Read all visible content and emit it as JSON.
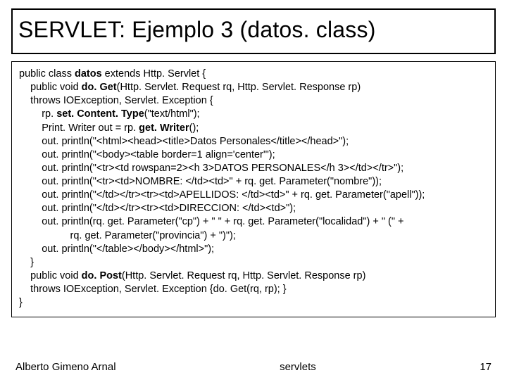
{
  "title": "SERVLET: Ejemplo 3 (datos. class)",
  "code": {
    "l01a": "public class ",
    "l01b": "datos",
    "l01c": " extends Http. Servlet {",
    "l02a": "    public void ",
    "l02b": "do. Get",
    "l02c": "(Http. Servlet. Request rq, Http. Servlet. Response rp)",
    "l03": "    throws IOException, Servlet. Exception {",
    "l04a": "        rp. ",
    "l04b": "set. Content. Type",
    "l04c": "(\"text/html\");",
    "l05a": "        Print. Writer out = rp. ",
    "l05b": "get. Writer",
    "l05c": "();",
    "l06": "        out. println(\"<html><head><title>Datos Personales</title></head>\");",
    "l07": "        out. println(\"<body><table border=1 align='center'\");",
    "l08": "        out. println(\"<tr><td rowspan=2><h 3>DATOS PERSONALES</h 3></td></tr>\");",
    "l09": "        out. println(\"<tr><td>NOMBRE: </td><td>\" + rq. get. Parameter(\"nombre\"));",
    "l10": "        out. println(\"</td></tr><tr><td>APELLIDOS: </td><td>\" + rq. get. Parameter(\"apell\"));",
    "l11": "        out. println(\"</td></tr><tr><td>DIRECCION: </td><td>\");",
    "l12": "        out. println(rq. get. Parameter(\"cp\") + \" \" + rq. get. Parameter(\"localidad\") + \" (\" +",
    "l13": "                  rq. get. Parameter(\"provincia\") + \")\");",
    "l14": "        out. println(\"</table></body></html>\");",
    "l15": "    }",
    "l16a": "    public void ",
    "l16b": "do. Post",
    "l16c": "(Http. Servlet. Request rq, Http. Servlet. Response rp)",
    "l17": "    throws IOException, Servlet. Exception {do. Get(rq, rp); }",
    "l18": "}"
  },
  "footer": {
    "author": "Alberto Gimeno Arnal",
    "center": "servlets",
    "page": "17"
  }
}
